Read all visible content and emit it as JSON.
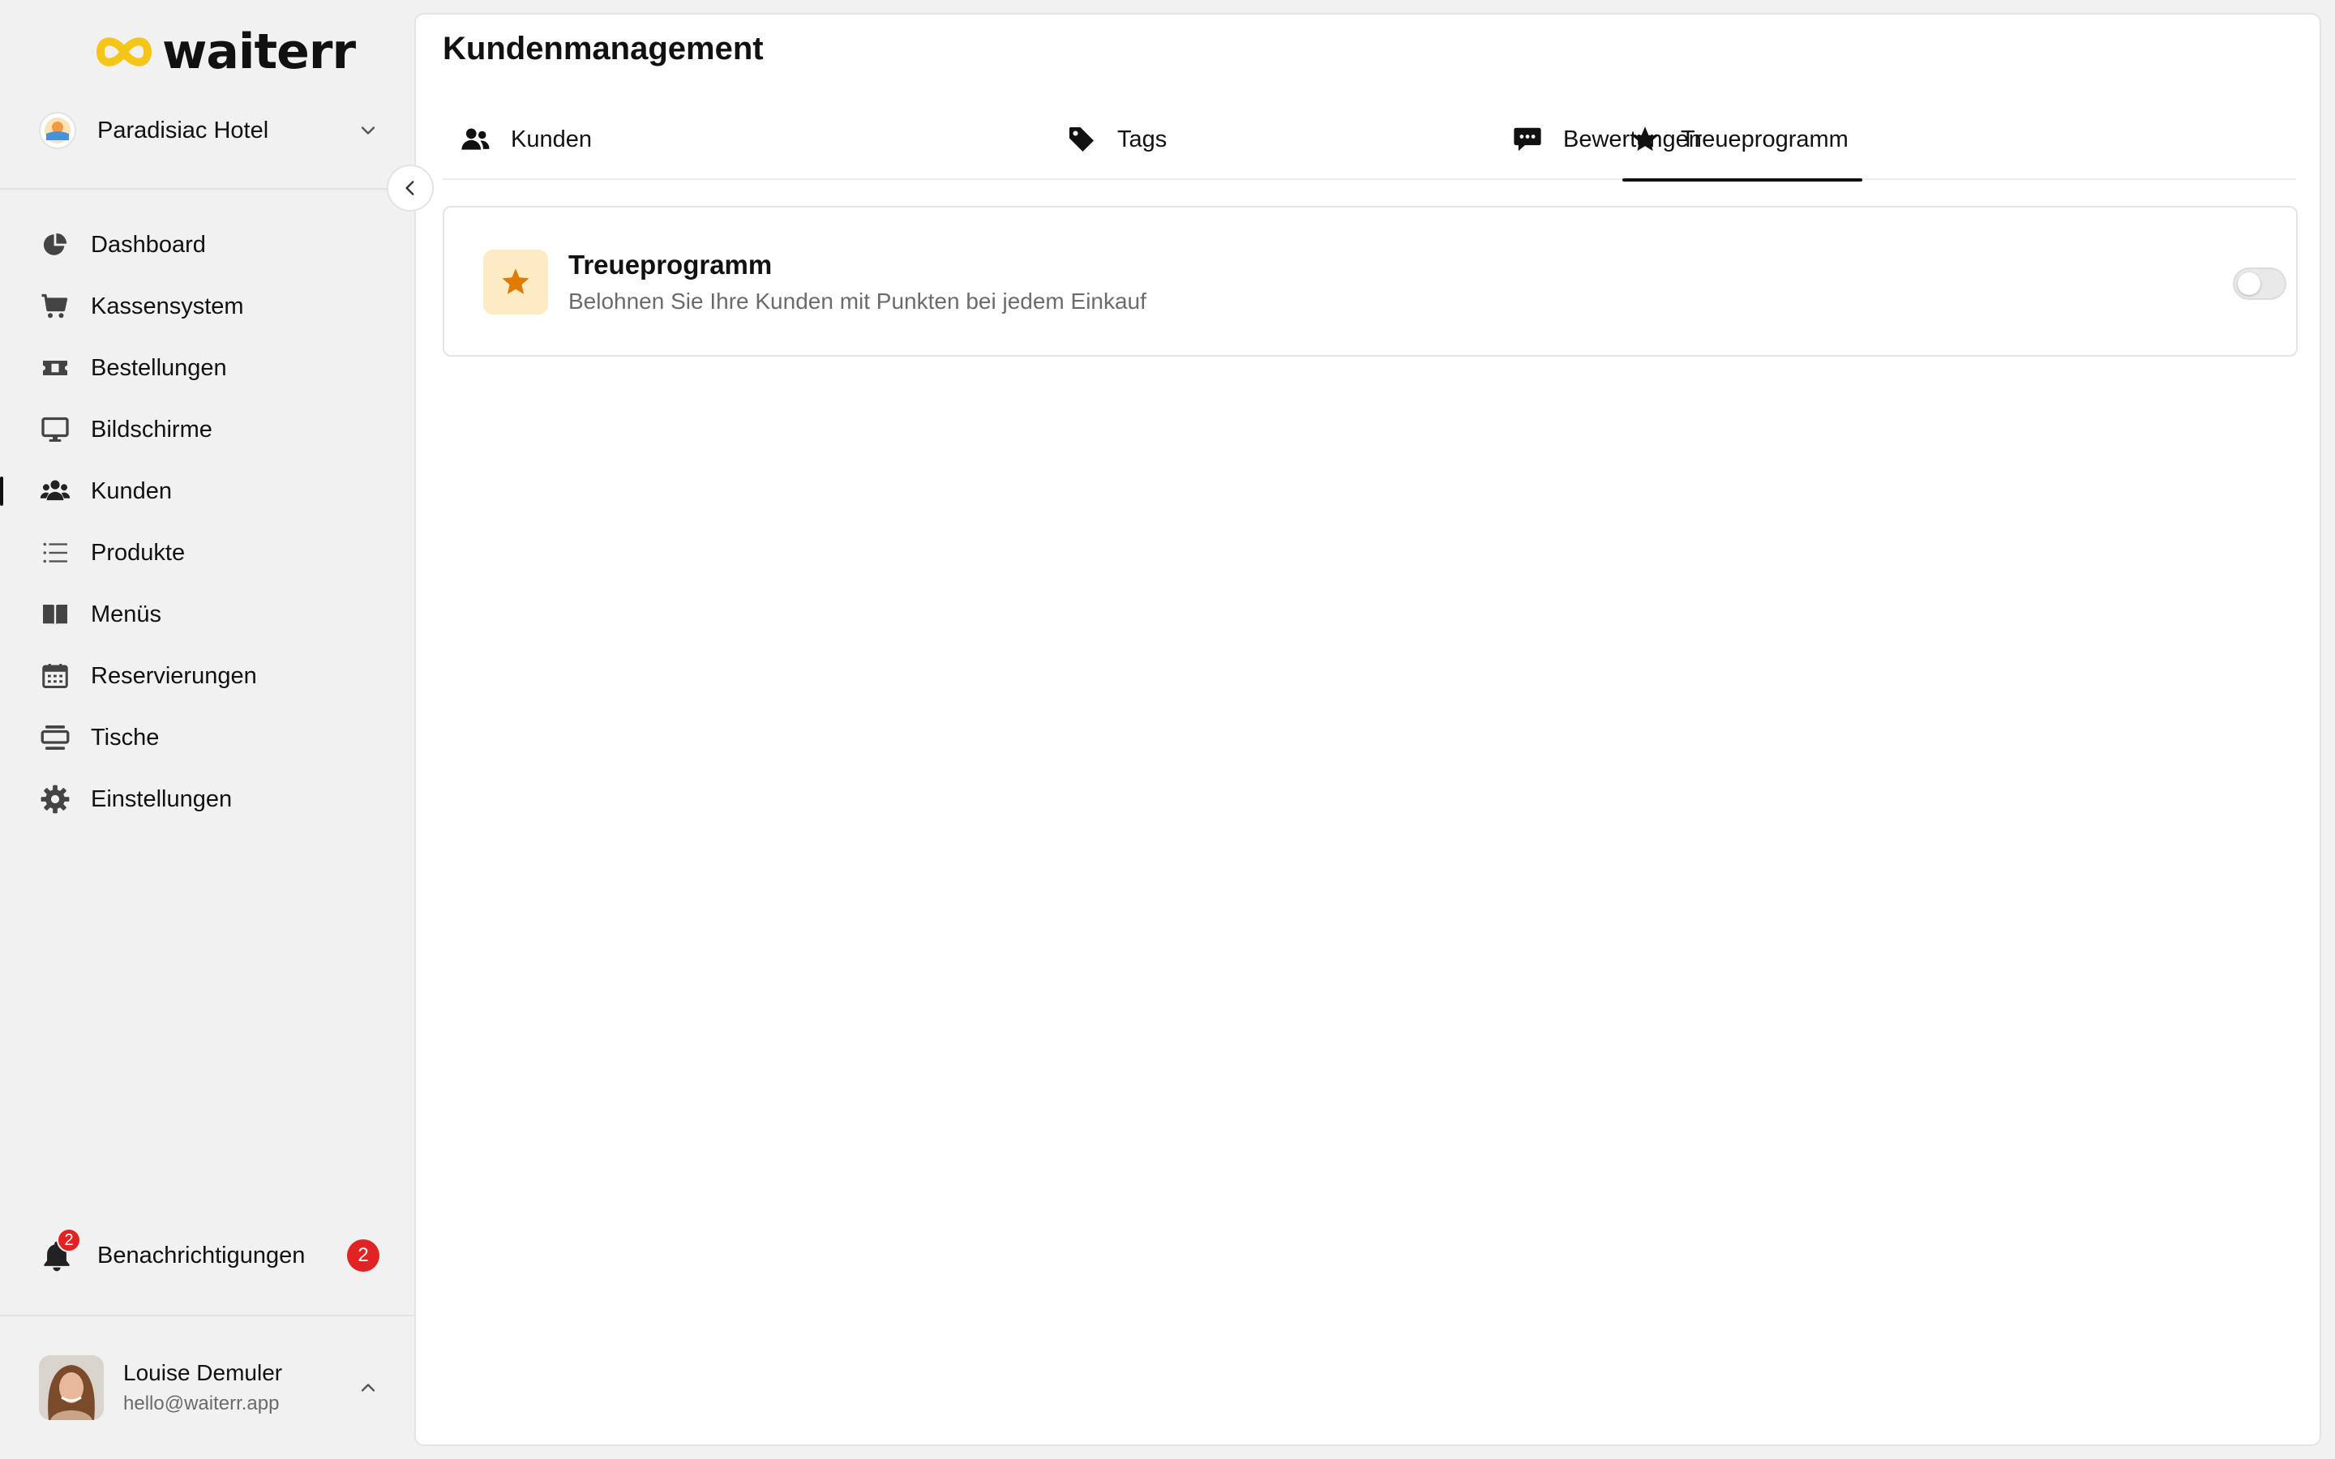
{
  "brand": {
    "name": "waiterr",
    "accent": "#f5c518"
  },
  "venue": {
    "name": "Paradisiac Hotel"
  },
  "nav": {
    "items": [
      {
        "label": "Dashboard",
        "icon": "pie-chart-icon"
      },
      {
        "label": "Kassensystem",
        "icon": "cart-icon"
      },
      {
        "label": "Bestellungen",
        "icon": "ticket-icon"
      },
      {
        "label": "Bildschirme",
        "icon": "monitor-icon"
      },
      {
        "label": "Kunden",
        "icon": "users-icon",
        "active": true
      },
      {
        "label": "Produkte",
        "icon": "list-icon"
      },
      {
        "label": "Menüs",
        "icon": "book-icon"
      },
      {
        "label": "Reservierungen",
        "icon": "calendar-icon"
      },
      {
        "label": "Tische",
        "icon": "table-icon"
      },
      {
        "label": "Einstellungen",
        "icon": "gear-icon"
      }
    ]
  },
  "notifications": {
    "label": "Benachrichtigungen",
    "count": "2",
    "badge_color": "#e02424"
  },
  "user": {
    "name": "Louise Demuler",
    "email": "hello@waiterr.app"
  },
  "page": {
    "title": "Kundenmanagement",
    "tabs": [
      {
        "label": "Kunden",
        "icon": "users-icon"
      },
      {
        "label": "Tags",
        "icon": "tag-icon"
      },
      {
        "label": "Treueprogramm",
        "icon": "star-icon",
        "active": true
      },
      {
        "label": "Bewertungen",
        "icon": "comment-icon"
      }
    ]
  },
  "loyalty_card": {
    "title": "Treueprogramm",
    "description": "Belohnen Sie Ihre Kunden mit Punkten bei jedem Einkauf",
    "icon": "star-icon",
    "icon_color": "#e07b00",
    "enabled": false
  }
}
